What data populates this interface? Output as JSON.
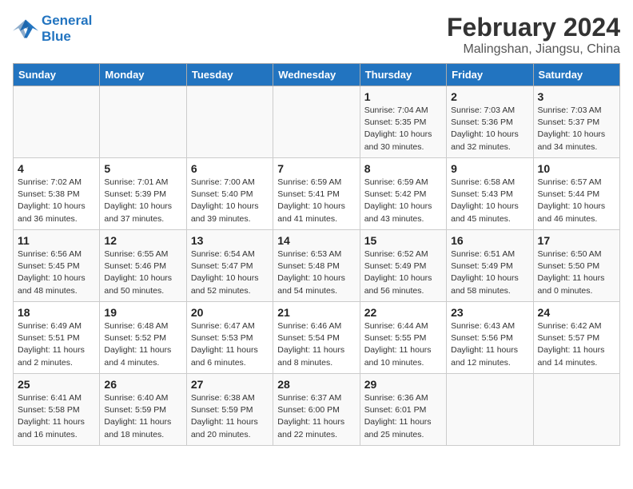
{
  "header": {
    "logo_line1": "General",
    "logo_line2": "Blue",
    "main_title": "February 2024",
    "sub_title": "Malingshan, Jiangsu, China"
  },
  "weekdays": [
    "Sunday",
    "Monday",
    "Tuesday",
    "Wednesday",
    "Thursday",
    "Friday",
    "Saturday"
  ],
  "weeks": [
    [
      {
        "num": "",
        "info": ""
      },
      {
        "num": "",
        "info": ""
      },
      {
        "num": "",
        "info": ""
      },
      {
        "num": "",
        "info": ""
      },
      {
        "num": "1",
        "info": "Sunrise: 7:04 AM\nSunset: 5:35 PM\nDaylight: 10 hours\nand 30 minutes."
      },
      {
        "num": "2",
        "info": "Sunrise: 7:03 AM\nSunset: 5:36 PM\nDaylight: 10 hours\nand 32 minutes."
      },
      {
        "num": "3",
        "info": "Sunrise: 7:03 AM\nSunset: 5:37 PM\nDaylight: 10 hours\nand 34 minutes."
      }
    ],
    [
      {
        "num": "4",
        "info": "Sunrise: 7:02 AM\nSunset: 5:38 PM\nDaylight: 10 hours\nand 36 minutes."
      },
      {
        "num": "5",
        "info": "Sunrise: 7:01 AM\nSunset: 5:39 PM\nDaylight: 10 hours\nand 37 minutes."
      },
      {
        "num": "6",
        "info": "Sunrise: 7:00 AM\nSunset: 5:40 PM\nDaylight: 10 hours\nand 39 minutes."
      },
      {
        "num": "7",
        "info": "Sunrise: 6:59 AM\nSunset: 5:41 PM\nDaylight: 10 hours\nand 41 minutes."
      },
      {
        "num": "8",
        "info": "Sunrise: 6:59 AM\nSunset: 5:42 PM\nDaylight: 10 hours\nand 43 minutes."
      },
      {
        "num": "9",
        "info": "Sunrise: 6:58 AM\nSunset: 5:43 PM\nDaylight: 10 hours\nand 45 minutes."
      },
      {
        "num": "10",
        "info": "Sunrise: 6:57 AM\nSunset: 5:44 PM\nDaylight: 10 hours\nand 46 minutes."
      }
    ],
    [
      {
        "num": "11",
        "info": "Sunrise: 6:56 AM\nSunset: 5:45 PM\nDaylight: 10 hours\nand 48 minutes."
      },
      {
        "num": "12",
        "info": "Sunrise: 6:55 AM\nSunset: 5:46 PM\nDaylight: 10 hours\nand 50 minutes."
      },
      {
        "num": "13",
        "info": "Sunrise: 6:54 AM\nSunset: 5:47 PM\nDaylight: 10 hours\nand 52 minutes."
      },
      {
        "num": "14",
        "info": "Sunrise: 6:53 AM\nSunset: 5:48 PM\nDaylight: 10 hours\nand 54 minutes."
      },
      {
        "num": "15",
        "info": "Sunrise: 6:52 AM\nSunset: 5:49 PM\nDaylight: 10 hours\nand 56 minutes."
      },
      {
        "num": "16",
        "info": "Sunrise: 6:51 AM\nSunset: 5:49 PM\nDaylight: 10 hours\nand 58 minutes."
      },
      {
        "num": "17",
        "info": "Sunrise: 6:50 AM\nSunset: 5:50 PM\nDaylight: 11 hours\nand 0 minutes."
      }
    ],
    [
      {
        "num": "18",
        "info": "Sunrise: 6:49 AM\nSunset: 5:51 PM\nDaylight: 11 hours\nand 2 minutes."
      },
      {
        "num": "19",
        "info": "Sunrise: 6:48 AM\nSunset: 5:52 PM\nDaylight: 11 hours\nand 4 minutes."
      },
      {
        "num": "20",
        "info": "Sunrise: 6:47 AM\nSunset: 5:53 PM\nDaylight: 11 hours\nand 6 minutes."
      },
      {
        "num": "21",
        "info": "Sunrise: 6:46 AM\nSunset: 5:54 PM\nDaylight: 11 hours\nand 8 minutes."
      },
      {
        "num": "22",
        "info": "Sunrise: 6:44 AM\nSunset: 5:55 PM\nDaylight: 11 hours\nand 10 minutes."
      },
      {
        "num": "23",
        "info": "Sunrise: 6:43 AM\nSunset: 5:56 PM\nDaylight: 11 hours\nand 12 minutes."
      },
      {
        "num": "24",
        "info": "Sunrise: 6:42 AM\nSunset: 5:57 PM\nDaylight: 11 hours\nand 14 minutes."
      }
    ],
    [
      {
        "num": "25",
        "info": "Sunrise: 6:41 AM\nSunset: 5:58 PM\nDaylight: 11 hours\nand 16 minutes."
      },
      {
        "num": "26",
        "info": "Sunrise: 6:40 AM\nSunset: 5:59 PM\nDaylight: 11 hours\nand 18 minutes."
      },
      {
        "num": "27",
        "info": "Sunrise: 6:38 AM\nSunset: 5:59 PM\nDaylight: 11 hours\nand 20 minutes."
      },
      {
        "num": "28",
        "info": "Sunrise: 6:37 AM\nSunset: 6:00 PM\nDaylight: 11 hours\nand 22 minutes."
      },
      {
        "num": "29",
        "info": "Sunrise: 6:36 AM\nSunset: 6:01 PM\nDaylight: 11 hours\nand 25 minutes."
      },
      {
        "num": "",
        "info": ""
      },
      {
        "num": "",
        "info": ""
      }
    ]
  ]
}
